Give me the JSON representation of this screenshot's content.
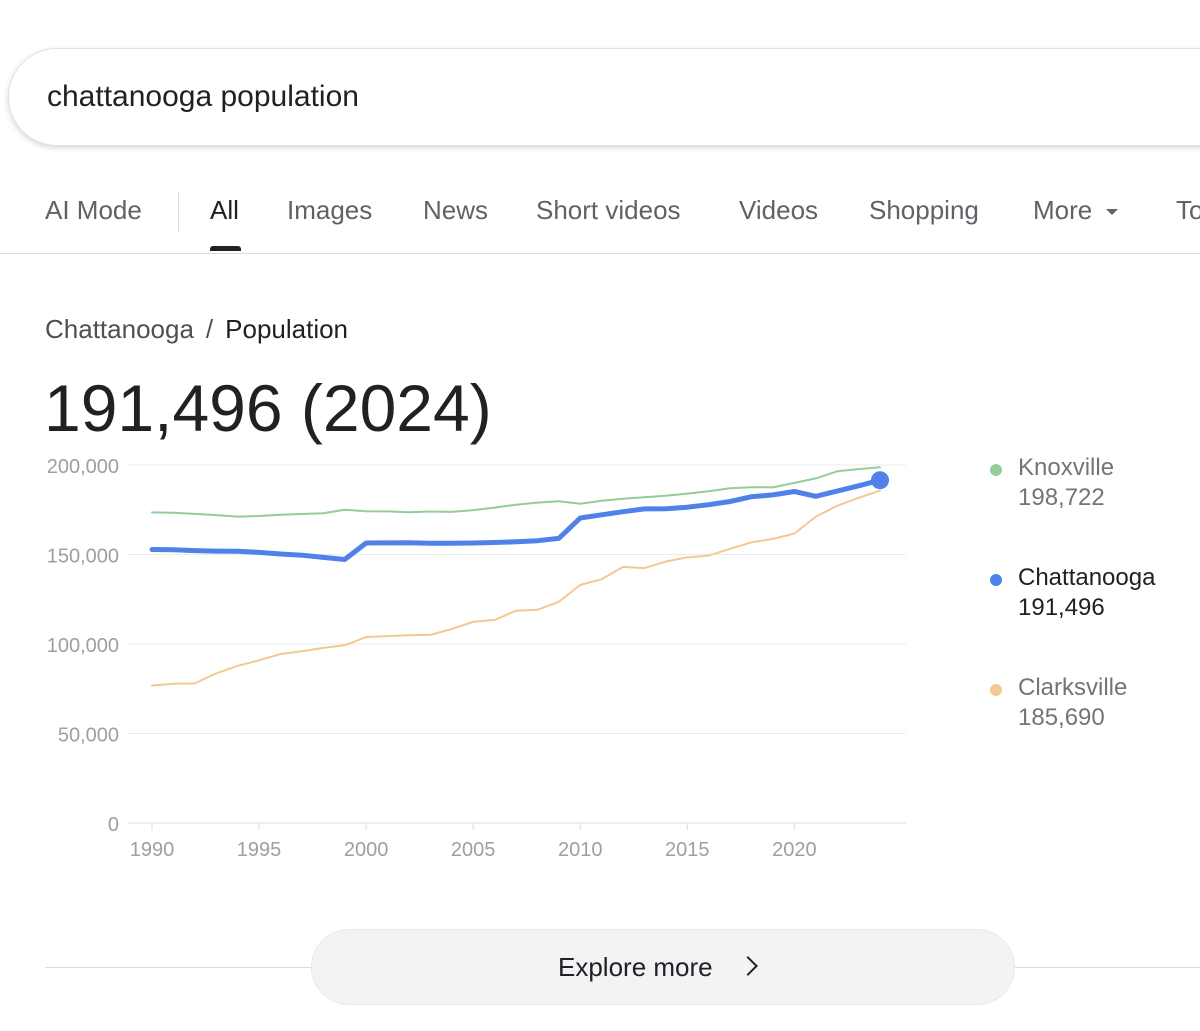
{
  "search": {
    "query": "chattanooga population"
  },
  "tabs": [
    {
      "label": "AI Mode"
    },
    {
      "label": "All"
    },
    {
      "label": "Images"
    },
    {
      "label": "News"
    },
    {
      "label": "Short videos"
    },
    {
      "label": "Videos"
    },
    {
      "label": "Shopping"
    },
    {
      "label": "More"
    },
    {
      "label": "To"
    }
  ],
  "breadcrumb": {
    "parent": "Chattanooga",
    "separator": "/",
    "current": "Population"
  },
  "headline": "191,496 (2024)",
  "legend": [
    {
      "name": "Knoxville",
      "value": "198,722",
      "color": "#93cd9a"
    },
    {
      "name": "Chattanooga",
      "value": "191,496",
      "color": "#4f81e8"
    },
    {
      "name": "Clarksville",
      "value": "185,690",
      "color": "#f4c98f"
    }
  ],
  "chart_data": {
    "type": "line",
    "ylim": [
      0,
      200000
    ],
    "xlim": [
      1990,
      2024
    ],
    "yticks": [
      0,
      50000,
      100000,
      150000,
      200000
    ],
    "ytick_labels": [
      "0",
      "50,000",
      "100,000",
      "150,000",
      "200,000"
    ],
    "xticks": [
      1990,
      1995,
      2000,
      2005,
      2010,
      2015,
      2020
    ],
    "xtick_labels": [
      "1990",
      "1995",
      "2000",
      "2005",
      "2010",
      "2015",
      "2020"
    ],
    "grid": true,
    "x": [
      1990,
      1991,
      1992,
      1993,
      1994,
      1995,
      1996,
      1997,
      1998,
      1999,
      2000,
      2001,
      2002,
      2003,
      2004,
      2005,
      2006,
      2007,
      2008,
      2009,
      2010,
      2011,
      2012,
      2013,
      2014,
      2015,
      2016,
      2017,
      2018,
      2019,
      2020,
      2021,
      2022,
      2023,
      2024
    ],
    "series": [
      {
        "name": "Knoxville",
        "color": "#93cd9a",
        "values": [
          173500,
          173300,
          172700,
          172000,
          171200,
          171500,
          172200,
          172600,
          173100,
          175000,
          174200,
          174100,
          173600,
          174000,
          173800,
          174800,
          176200,
          177800,
          179000,
          179700,
          178400,
          180000,
          181200,
          182000,
          182800,
          184000,
          185300,
          187000,
          187600,
          187500,
          190000,
          192500,
          196500,
          197700,
          198722
        ]
      },
      {
        "name": "Chattanooga",
        "color": "#4f81e8",
        "values": [
          152800,
          152600,
          152200,
          151900,
          151800,
          151200,
          150300,
          149600,
          148400,
          147200,
          156400,
          156500,
          156600,
          156300,
          156300,
          156400,
          156700,
          157100,
          157700,
          159000,
          170400,
          172200,
          173900,
          175500,
          175600,
          176400,
          177800,
          179600,
          182300,
          183300,
          185200,
          182500,
          185400,
          188400,
          191496
        ]
      },
      {
        "name": "Clarksville",
        "color": "#f4c98f",
        "values": [
          76800,
          77800,
          78000,
          83600,
          87800,
          90900,
          94400,
          96000,
          97800,
          99300,
          103900,
          104400,
          104900,
          105100,
          108400,
          112400,
          113400,
          118600,
          119100,
          123600,
          133000,
          136200,
          143100,
          142400,
          146100,
          148400,
          149400,
          153200,
          156800,
          158700,
          161700,
          171200,
          177200,
          181700,
          185690
        ]
      }
    ]
  }
}
